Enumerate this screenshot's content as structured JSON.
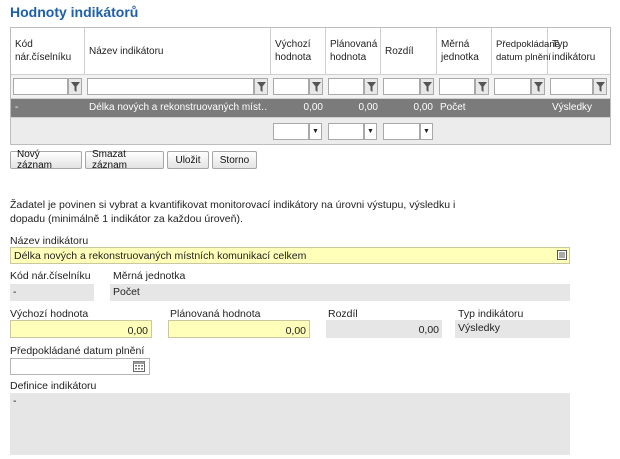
{
  "title": "Hodnoty indikátorů",
  "grid": {
    "headers": [
      "Kód nár.číselníku",
      "Název indikátoru",
      "Výchozí hodnota",
      "Plánovaná hodnota",
      "Rozdíl",
      "Měrná jednotka",
      "Předpokládané datum plnění",
      "Typ indikátoru"
    ],
    "row": {
      "kod": "-",
      "nazev": "Délka nových a rekonstruovaných míst…",
      "vychozi": "0,00",
      "planovana": "0,00",
      "rozdil": "0,00",
      "jednotka": "Počet",
      "datum": "",
      "typ": "Výsledky"
    }
  },
  "buttons": {
    "new": "Nový záznam",
    "delete": "Smazat záznam",
    "save": "Uložit",
    "cancel": "Storno"
  },
  "info_text": "Žadatel je povinen si vybrat a kvantifikovat monitorovací indikátory na úrovni výstupu, výsledku i dopadu (minimálně 1 indikátor za každou úroveň).",
  "form": {
    "nazev_label": "Název indikátoru",
    "nazev_value": "Délka nových a rekonstruovaných místních komunikací celkem",
    "kod_label": "Kód nár.číselníku",
    "kod_value": "-",
    "jednotka_label": "Měrná jednotka",
    "jednotka_value": "Počet",
    "vychozi_label": "Výchozí hodnota",
    "vychozi_value": "0,00",
    "planovana_label": "Plánovaná hodnota",
    "planovana_value": "0,00",
    "rozdil_label": "Rozdíl",
    "rozdil_value": "0,00",
    "typ_label": "Typ indikátoru",
    "typ_value": "Výsledky",
    "datum_label": "Předpokládané datum plnění",
    "datum_value": "",
    "definice_label": "Definice indikátoru",
    "definice_value": "-"
  },
  "colors": {
    "title": "#1d5fa8",
    "required_field": "#ffffb9",
    "readonly_field": "#e6e6e6",
    "selected_row": "#7b7b7b"
  }
}
